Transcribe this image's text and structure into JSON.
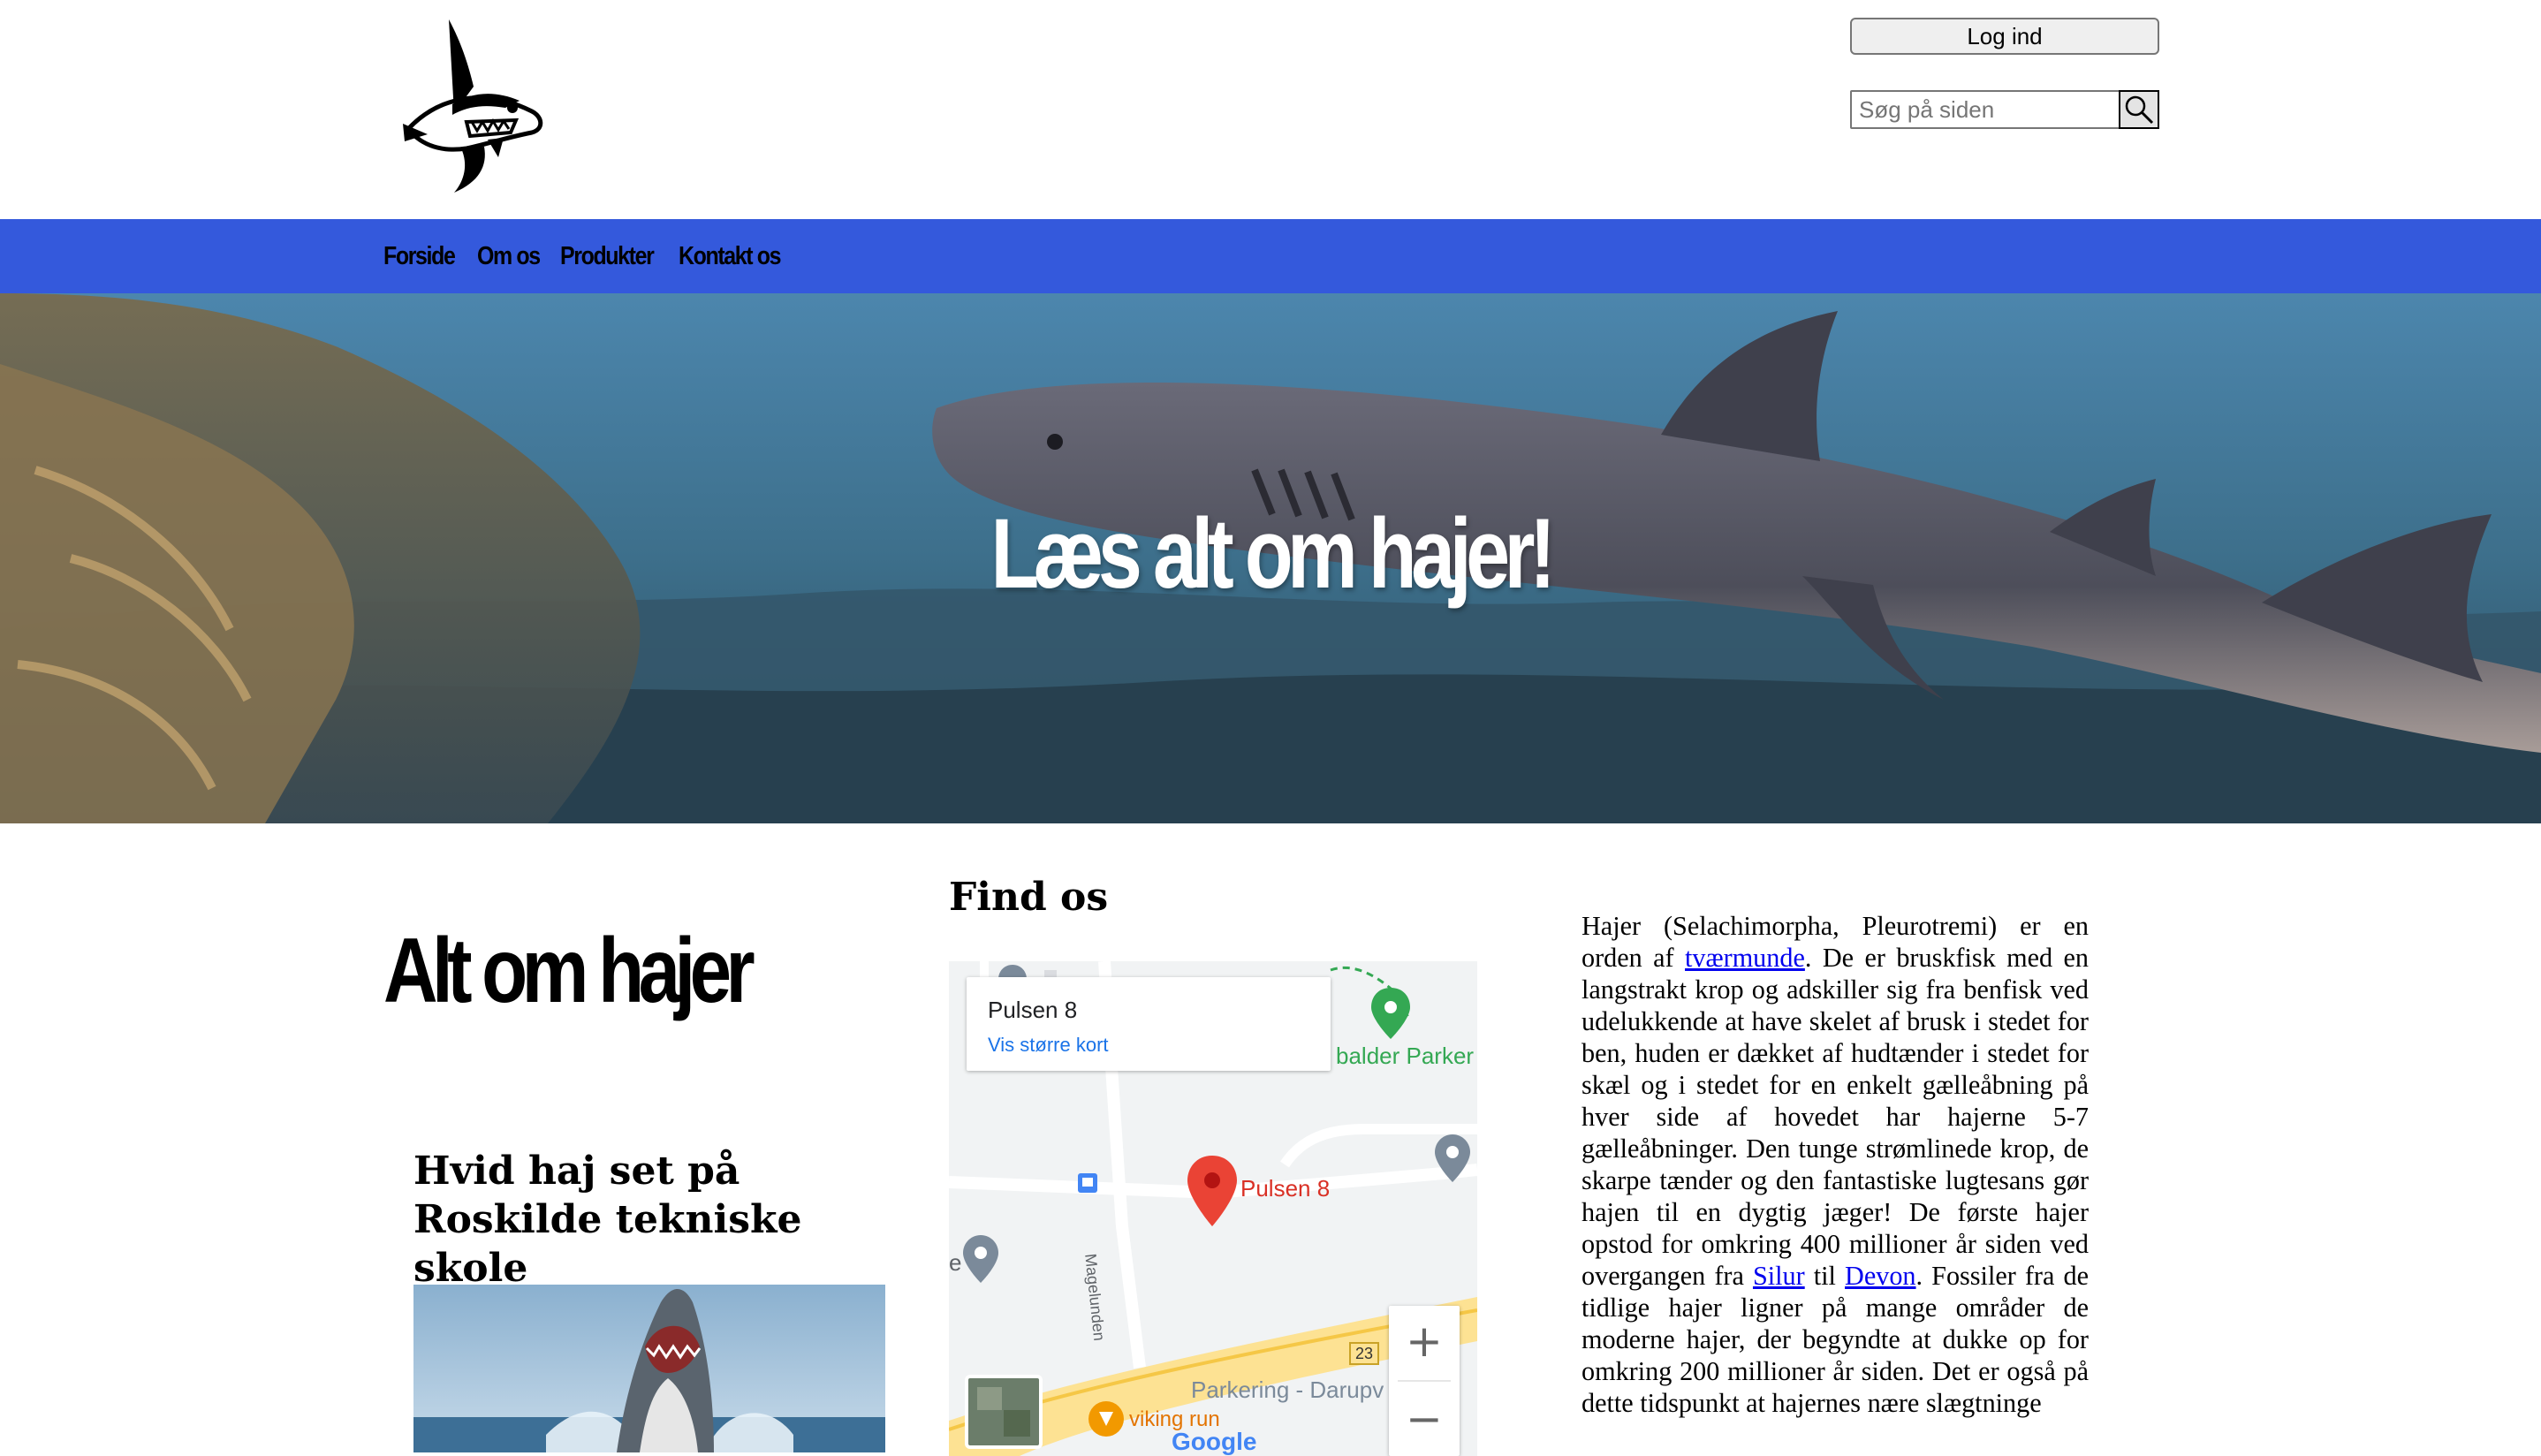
{
  "header": {
    "login_label": "Log ind",
    "search": {
      "placeholder": "Søg på siden",
      "value": ""
    },
    "logo_icon": "shark-logo-icon",
    "search_icon": "magnifier-icon"
  },
  "nav": {
    "items": [
      {
        "label": "Forside"
      },
      {
        "label": "Om os"
      },
      {
        "label": "Produkter"
      },
      {
        "label": "Kontakt os"
      }
    ],
    "background": "#3459dc"
  },
  "hero": {
    "title": "Læs alt om hajer!"
  },
  "main": {
    "page_title": "Alt om hajer",
    "article": {
      "title": "Hvid haj set på Roskilde tekniske skole"
    },
    "find": {
      "title": "Find os",
      "map": {
        "card_title": "Pulsen 8",
        "card_link": "Vis større kort",
        "pin_label": "Pulsen 8",
        "labels": {
          "park": "balder Parker",
          "street": "Magelunden",
          "parking": "Parkering - Darupv",
          "route_number": "23",
          "place": "viking run",
          "brand": "Google",
          "partial": "e"
        },
        "zoom_in": "+",
        "zoom_out": "−"
      }
    },
    "body": {
      "p1": "Hajer (Selachimorpha, Pleurotremi) er en orden af ",
      "link1": "tværmunde",
      "p2": ". De er bruskfisk med en langstrakt krop og adskiller sig fra benfisk ved udelukkende at have skelet af brusk i stedet for ben, huden er dækket af hudtænder i stedet for skæl og i stedet for en enkelt gælleåbning på hver side af hovedet har hajerne 5-7 gælleåbninger. Den tunge strømlinede krop, de skarpe tænder og den fantastiske lugtesans gør hajen til en dygtig jæger! De første hajer opstod for omkring 400 millioner år siden ved overgangen fra ",
      "link2": "Silur",
      "p3": " til ",
      "link3": "Devon",
      "p4": ". Fossiler fra de tidlige hajer ligner på mange områder de moderne hajer, der begyndte at dukke op for omkring 200 millioner år siden. Det er også på dette tidspunkt at hajernes nære slægtninge"
    }
  }
}
